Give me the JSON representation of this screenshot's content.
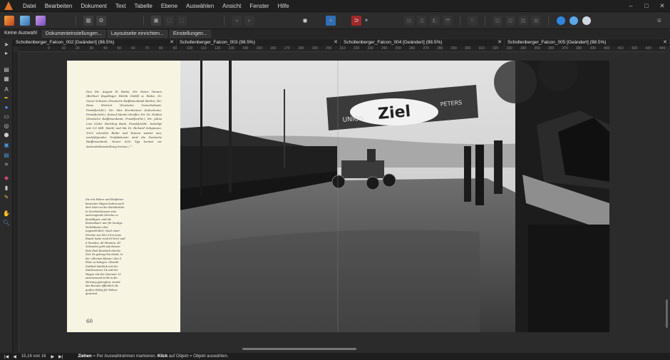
{
  "menu": [
    "Datei",
    "Bearbeiten",
    "Dokument",
    "Text",
    "Tabelle",
    "Ebene",
    "Auswählen",
    "Ansicht",
    "Fenster",
    "Hilfe"
  ],
  "window_controls": [
    "–",
    "□",
    "✕"
  ],
  "context_bar": {
    "selection": "Keine Auswahl",
    "buttons": [
      "Dokumenteinstellungen...",
      "Layoutseite einrichten...",
      "Einstellungen..."
    ]
  },
  "tabs": [
    {
      "title": "Schollenberger_Falcon_002 [Geändert] (98.5%)"
    },
    {
      "title": "Schollenberger_Falcon_003 (98.5%)"
    },
    {
      "title": "Schollenberger_Falcon_004 [Geändert] (98.5%)"
    },
    {
      "title": "Schollenberger_Falcon_005 [Geändert] (98.5%)"
    }
  ],
  "ruler_labels": [
    "0",
    "10",
    "20",
    "30",
    "40",
    "50",
    "60",
    "70",
    "80",
    "90",
    "100",
    "110",
    "120",
    "130",
    "140",
    "150",
    "160",
    "170",
    "180",
    "190",
    "200",
    "210",
    "220",
    "230",
    "240",
    "250",
    "260",
    "270",
    "280",
    "290",
    "300",
    "310",
    "320",
    "330",
    "340",
    "350",
    "360",
    "370",
    "380",
    "390",
    "400",
    "410",
    "420",
    "430",
    "440"
  ],
  "page": {
    "body_text": "Den Dir. August W. Riebe, Dir. Heinz Tannen (Berliner Kugellager Fabrik GmbH A. Riebe, Dr. Oscar Schwarz (Deutsche Raiffeisenbank Berlin), Dir. Hans Wichert (Deutsche Gewerbebank, Frankfurt/M.), Dir. Max Kronheimer (Inducheme, Frankfurt/M.), Konsul Martin Streffer, Dir. Dr. Nolden (Deutsche Raiffeisenbank, Frankfurt/M.), Dir. Julius Levi (Gebr. Röchling Bank, Frankfurt/M., beteiligt mit 5,9 Mill. Mark) und RA Dr. Richard Seligmann. 1925 scheiden Riebe und Tannen wieder aus; nachfolgender Großaktionär wird die Deutsche Raiffeisenbank. Neuer 6/30 Typ kommt zur Automobilausstellung heraus.« ⁶",
    "caption": "Die mit Fahrer und Beifahrer besetzten Wagen hatten nach dem Start an der Karlsbrücke in Dornholzhausen eine anstrengende Strecke zu bewältigen, und die Rennedauer war für heutige Verhältnisse eher ungewöhnlich: Nach einer Strecke von 433,5 km (eine Runde hatte rund 65 km!) und 6 Stunden, 46 Minuten, 49 Sekunden geht auf diesem Foto Emil Reisbach durchs Ziel. Es gelang ihm damit, in der »Kleinen Klasse« den 4. Platz zu belegen. Obwohl Gottlieb Hartlieb mit der Startnummer 14 und der Wagen mit der Nummer 13 anscheinend nicht in die Wertung gelangten, wurde das Rennen öffentlich als großer Erfolg für Falcon gewertet.",
    "page_number": "60"
  },
  "photo": {
    "banner_main": "Ziel",
    "banner_left": "UNION",
    "banner_right": "PETERS"
  },
  "status": {
    "nav_first": "|◀",
    "nav_prev": "◀",
    "page_indicator": "15,16 von 16",
    "nav_next": "▶",
    "nav_last": "▶|",
    "hint_key1": "Ziehen",
    "hint_text1": "= Per Auswahlrahmen markieren.",
    "hint_key2": "Klick",
    "hint_text2": "auf Objekt = Objekt auswählen."
  }
}
